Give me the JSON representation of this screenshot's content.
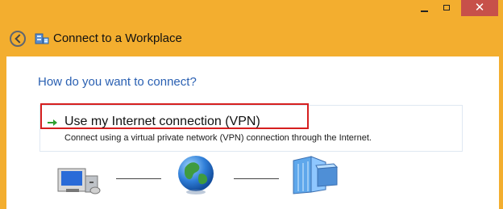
{
  "window": {
    "title": "Connect to a Workplace",
    "close_glyph": "✕",
    "icons": {
      "back": "back-arrow-icon",
      "wizard": "connect-workplace-icon",
      "option_arrow": "green-arrow-icon",
      "computer": "computer-icon",
      "globe": "globe-icon",
      "building": "office-building-icon"
    }
  },
  "content": {
    "question": "How do you want to connect?",
    "option": {
      "title": "Use my Internet connection (VPN)",
      "description": "Connect using a virtual private network (VPN) connection through the Internet."
    }
  },
  "colors": {
    "frame": "#f3ae2f",
    "question_text": "#2a60b2",
    "highlight": "#d61f1f",
    "close_button": "#c7504a"
  }
}
